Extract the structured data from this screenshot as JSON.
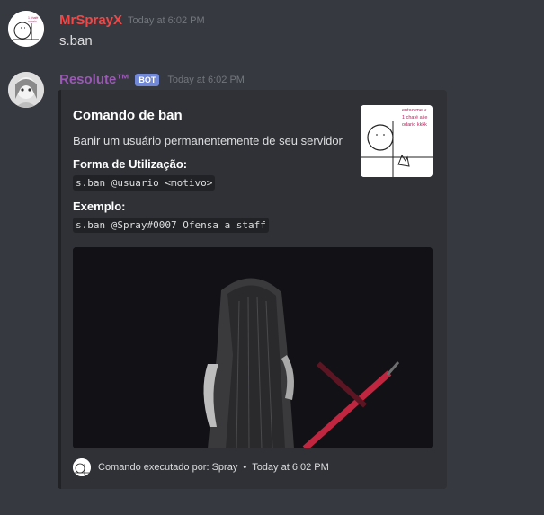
{
  "messages": [
    {
      "username": "MrSprayX",
      "username_color": "#f04747",
      "timestamp": "Today at 6:02 PM",
      "content": "s.ban",
      "avatar_text": "1 chafé ai e odario kkkk"
    },
    {
      "username": "Resolute™",
      "username_color": "#9b59b6",
      "bot_tag": "BOT",
      "timestamp": "Today at 6:02 PM"
    }
  ],
  "embed": {
    "title": "Comando de ban",
    "description": "Banir um usuário permanentemente de seu servidor",
    "fields": [
      {
        "name": "Forma de Utilização:",
        "value": "s.ban @usuario <motivo>"
      },
      {
        "name": "Exemplo:",
        "value": "s.ban @Spray#0007 Ofensa a staff"
      }
    ],
    "thumbnail_text": [
      "entao me v",
      "1 chafé ai e",
      "odario kkkk"
    ],
    "footer": {
      "text": "Comando executado por: Spray",
      "separator": "•",
      "timestamp": "Today at 6:02 PM"
    }
  }
}
